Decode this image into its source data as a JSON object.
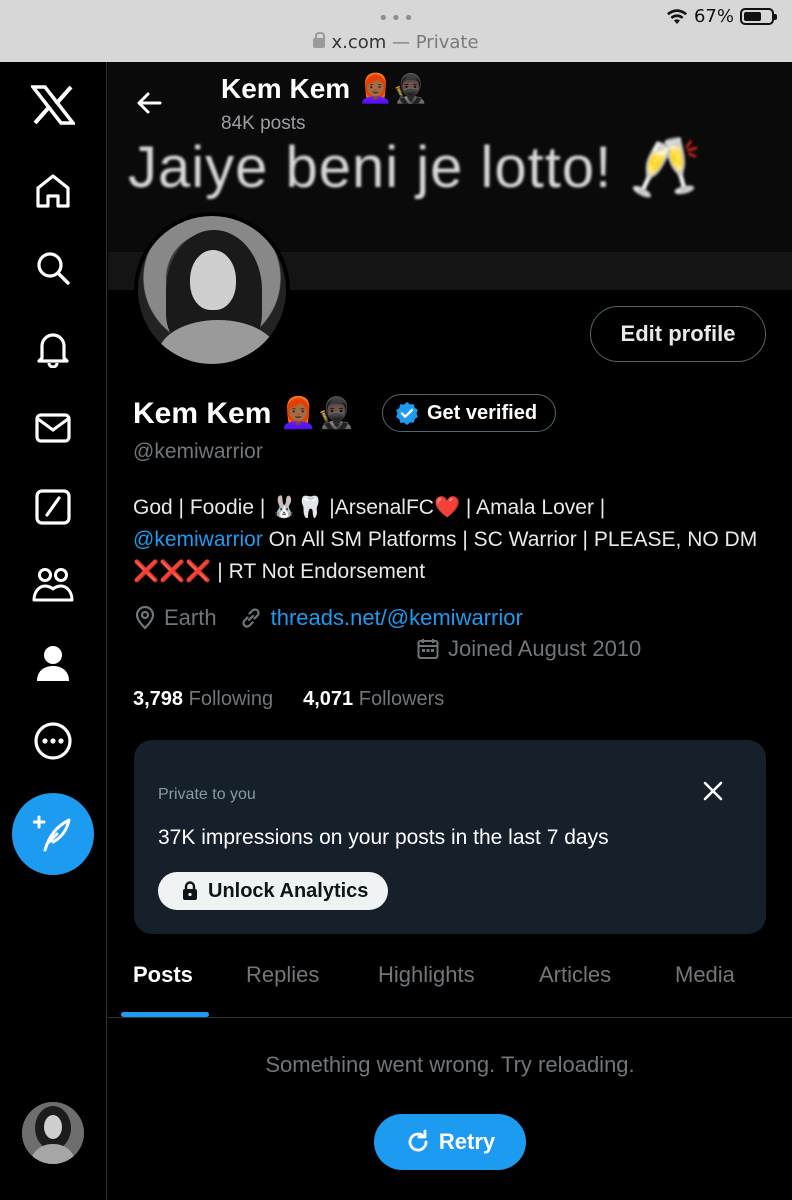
{
  "browser": {
    "domain": "x.com",
    "mode": "Private",
    "separator": "—",
    "battery_label": "67%",
    "battery_level": 0.67
  },
  "header": {
    "name": "Kem Kem 👩🏾‍🦰🥷🏿",
    "posts": "84K posts"
  },
  "banner": {
    "text": "Jaiye beni je lotto! 🥂"
  },
  "profile": {
    "edit_label": "Edit profile",
    "name": "Kem Kem 👩🏾‍🦰🥷🏿",
    "verify_label": "Get verified",
    "handle": "@kemiwarrior",
    "bio_part1": "God | Foodie | 🐰🦷 |ArsenalFC",
    "bio_heart": "❤️",
    "bio_part2": " | Amala Lover |",
    "bio_link": "@kemiwarrior",
    "bio_part3": " On All SM Platforms | SC Warrior | PLEASE, NO DM ",
    "bio_x": "❌❌❌",
    "bio_part4": " | RT Not Endorsement",
    "location": "Earth",
    "website": "threads.net/@kemiwarrior",
    "joined": "Joined August 2010",
    "following_count": "3,798",
    "following_label": "Following",
    "followers_count": "4,071",
    "followers_label": "Followers"
  },
  "analytics_card": {
    "private_label": "Private to you",
    "impressions_text": "37K impressions on your posts in the last 7 days",
    "unlock_label": "Unlock Analytics"
  },
  "tabs": [
    {
      "label": "Posts",
      "active": true
    },
    {
      "label": "Replies",
      "active": false
    },
    {
      "label": "Highlights",
      "active": false
    },
    {
      "label": "Articles",
      "active": false
    },
    {
      "label": "Media",
      "active": false
    }
  ],
  "feed": {
    "error_text": "Something went wrong. Try reloading.",
    "retry_label": "Retry"
  },
  "colors": {
    "accent": "#1d9bf0",
    "background": "#000000",
    "card": "#15202b"
  }
}
